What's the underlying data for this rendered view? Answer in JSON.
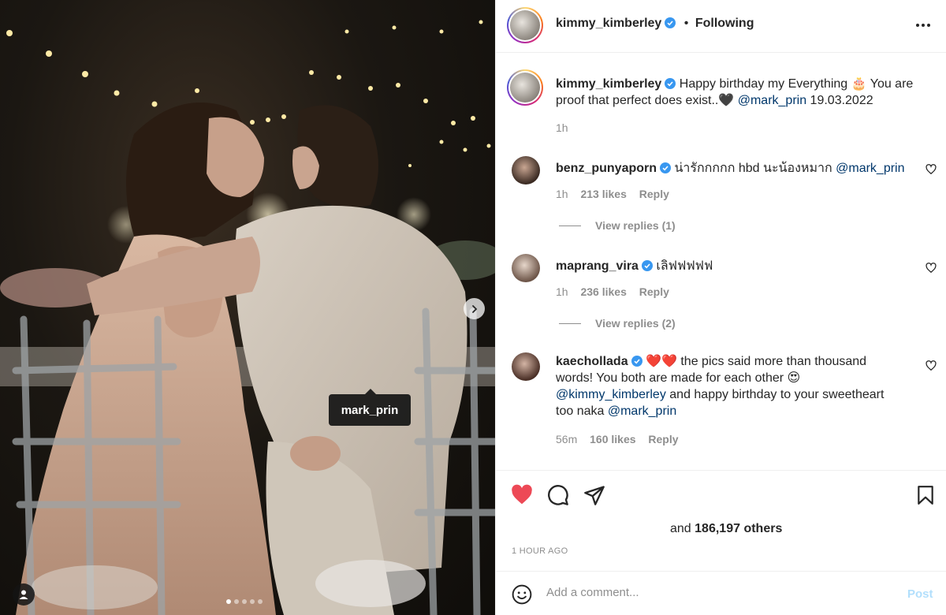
{
  "post": {
    "author": "kimmy_kimberley",
    "follow_status": "Following",
    "separator": "•",
    "photo_tag": "mark_prin",
    "carousel_count": 5,
    "carousel_active": 1
  },
  "caption": {
    "username": "kimmy_kimberley",
    "text_1": "Happy birthday my Everything",
    "emoji_cake": "🎂",
    "text_2": "You are",
    "text_3": "proof that perfect does exist..",
    "emoji_heart": "🖤",
    "mention": "@mark_prin",
    "date": "19.03.2022",
    "time": "1h"
  },
  "comments": [
    {
      "username": "benz_punyaporn",
      "text": "น่ารักกกกก hbd นะน้องหมาก",
      "mention": "@mark_prin",
      "time": "1h",
      "likes": "213 likes",
      "reply": "Reply",
      "view_replies": "View replies (1)"
    },
    {
      "username": "maprang_vira",
      "text": "เลิฟฟฟฟฟ",
      "time": "1h",
      "likes": "236 likes",
      "reply": "Reply",
      "view_replies": "View replies (2)"
    },
    {
      "username": "kaechollada",
      "hearts": "❤️❤️",
      "line1": "the pics said more than thousand",
      "line2": "words! You both are made for each other",
      "emoji": "😍",
      "mention1": "@kimmy_kimberley",
      "line3": "and happy birthday to your sweetheart",
      "line4a": "too naka",
      "mention2": "@mark_prin",
      "time": "56m",
      "likes": "160 likes",
      "reply": "Reply"
    }
  ],
  "actions": {
    "likes_prefix": "and",
    "likes_count": "186,197 others",
    "timestamp": "1 HOUR AGO"
  },
  "compose": {
    "placeholder": "Add a comment...",
    "post_label": "Post"
  },
  "colors": {
    "like_red": "#ed4956",
    "link_blue": "#00376b",
    "verified_blue": "#3897f0",
    "post_disabled": "#b2dffc"
  },
  "icons": {
    "more": "more-horizontal-icon",
    "like": "heart-filled-icon",
    "comment": "comment-bubble-icon",
    "share": "paper-plane-icon",
    "save": "bookmark-icon",
    "emoji": "smiley-icon",
    "user_tag": "person-icon",
    "next": "chevron-right-icon"
  }
}
